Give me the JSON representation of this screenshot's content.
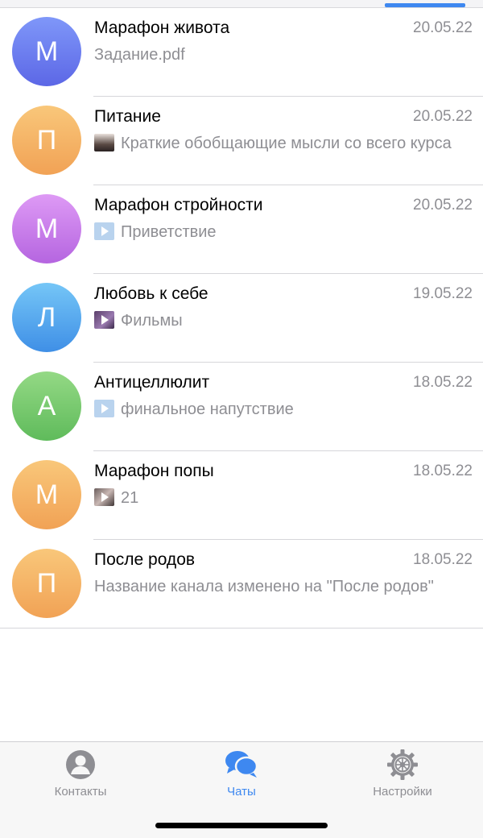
{
  "colors": {
    "accent": "#3e88f0",
    "secondary_text": "#8e8e93",
    "separator": "#d6d6da"
  },
  "chats": [
    {
      "initial": "М",
      "name": "Марафон живота",
      "date": "20.05.22",
      "preview_icon": "",
      "preview": "Задание.pdf"
    },
    {
      "initial": "П",
      "name": "Питание",
      "date": "20.05.22",
      "preview_icon": "photo-thumbnail",
      "preview": "Краткие обобщающие мысли со всего курса"
    },
    {
      "initial": "М",
      "name": "Марафон стройности",
      "date": "20.05.22",
      "preview_icon": "video-thumbnail",
      "preview": "Приветствие"
    },
    {
      "initial": "Л",
      "name": "Любовь к себе",
      "date": "19.05.22",
      "preview_icon": "video-thumbnail",
      "preview": "Фильмы"
    },
    {
      "initial": "А",
      "name": "Антицеллюлит",
      "date": "18.05.22",
      "preview_icon": "video-thumbnail",
      "preview": "финальное напутствие"
    },
    {
      "initial": "М",
      "name": "Марафон попы",
      "date": "18.05.22",
      "preview_icon": "video-thumbnail",
      "preview": "21"
    },
    {
      "initial": "П",
      "name": "После родов",
      "date": "18.05.22",
      "preview_icon": "",
      "preview": "Название канала изменено на \"После родов\""
    }
  ],
  "tabbar": {
    "contacts": {
      "label": "Контакты",
      "icon": "person-circle-icon"
    },
    "chats": {
      "label": "Чаты",
      "icon": "chat-bubbles-icon",
      "active": true
    },
    "settings": {
      "label": "Настройки",
      "icon": "gear-icon"
    }
  }
}
